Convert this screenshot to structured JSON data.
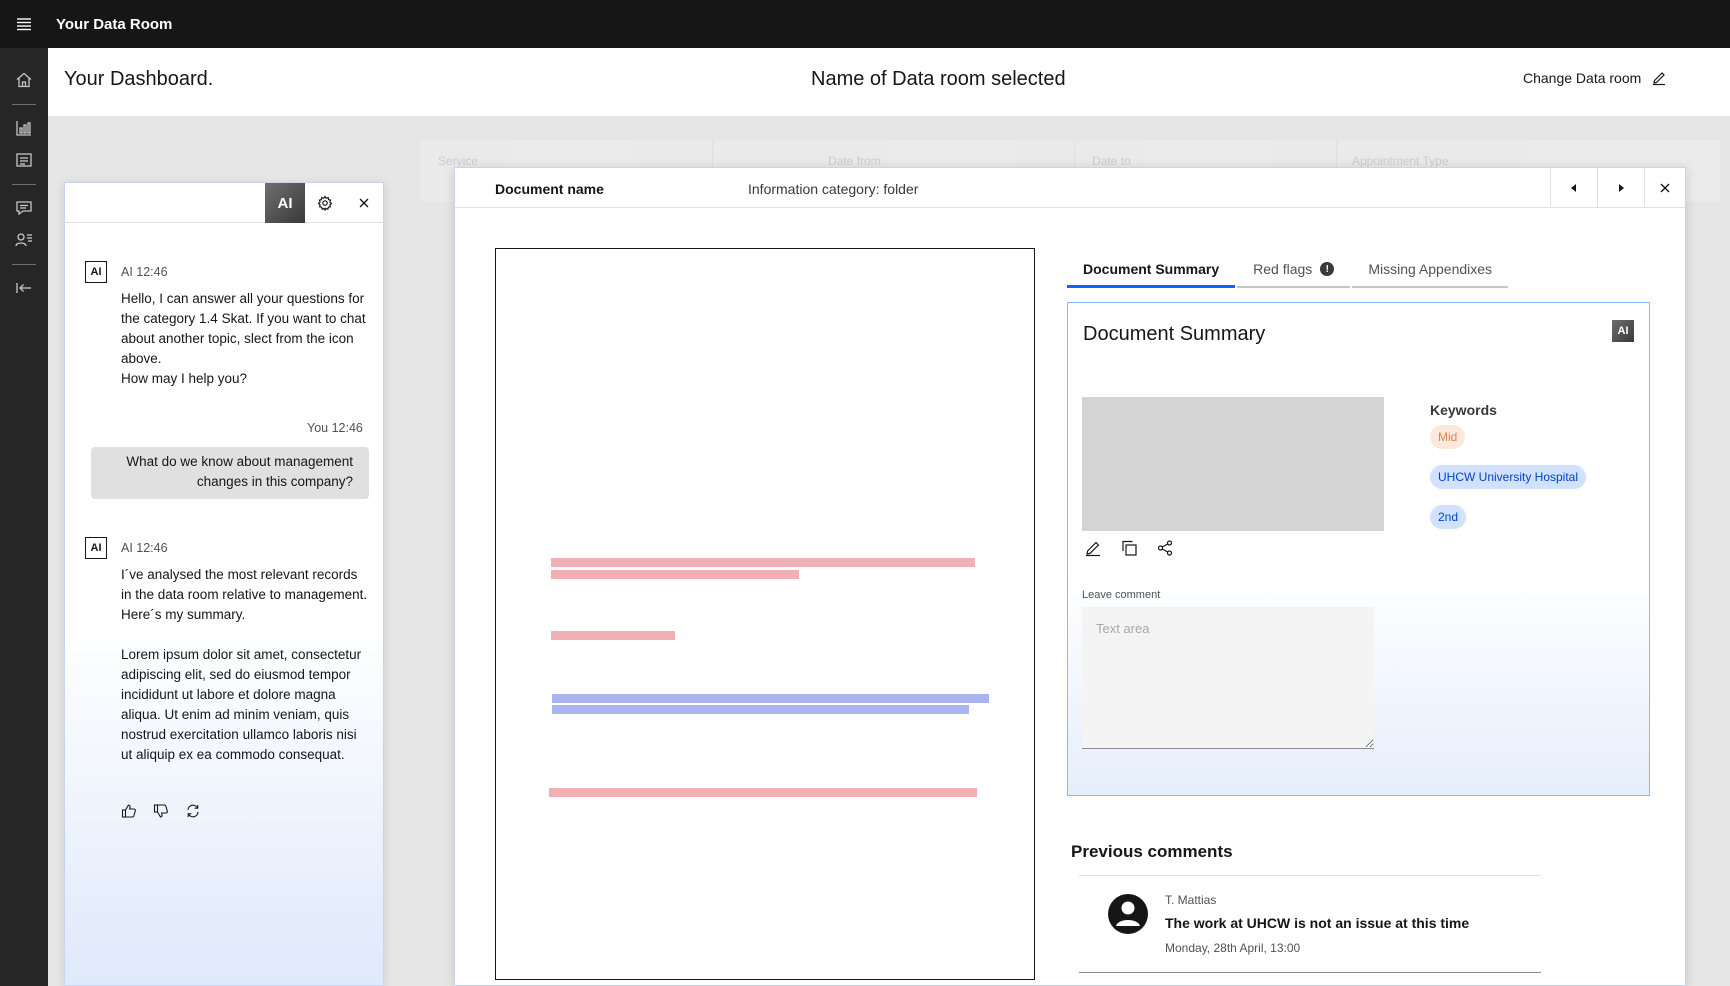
{
  "app": {
    "title": "Your Data Room"
  },
  "sidebar": {
    "items": [
      {
        "icon": "home-icon"
      },
      {
        "icon": "bar-chart-icon"
      },
      {
        "icon": "document-list-icon"
      },
      {
        "icon": "chat-icon"
      },
      {
        "icon": "user-list-icon"
      },
      {
        "icon": "logout-icon"
      }
    ]
  },
  "header": {
    "title": "Your Dashboard.",
    "dataroom_name": "Name of Data room selected",
    "change_label": "Change Data room"
  },
  "background_table": {
    "columns": [
      "Service",
      "Date from",
      "Date to",
      "Appointment Type"
    ]
  },
  "chat": {
    "ai_badge": "AI",
    "messages": [
      {
        "sender": "AI",
        "meta": "AI 12:46",
        "text": "Hello, I can answer all your questions for the category 1.4 Skat. If you want to chat about another topic, slect from the icon above.\nHow may I help you?"
      },
      {
        "sender": "You",
        "meta": "You 12:46",
        "text": "What do we know about management changes in this company?"
      },
      {
        "sender": "AI",
        "meta": "AI 12:46",
        "text": "I´ve analysed the most relevant records in the data room relative to management. Here´s my summary.\n\nLorem ipsum dolor sit amet, consectetur adipiscing elit, sed do eiusmod tempor incididunt ut labore et dolore magna aliqua. Ut enim ad minim veniam, quis nostrud exercitation ullamco laboris nisi ut aliquip ex ea commodo consequat."
      }
    ]
  },
  "document": {
    "name": "Document name",
    "category": "Information category: folder",
    "tabs": [
      {
        "label": "Document Summary",
        "active": true
      },
      {
        "label": "Red flags",
        "info": "!"
      },
      {
        "label": "Missing Appendixes"
      }
    ],
    "summary": {
      "title": "Document Summary",
      "ai_badge": "AI",
      "keywords_label": "Keywords",
      "keywords": [
        {
          "label": "Mid",
          "color": "#fde9dc"
        },
        {
          "label": "UHCW University Hospital",
          "color": "#d0e2ff"
        },
        {
          "label": "2nd",
          "color": "#d0e2ff"
        }
      ],
      "comment_label": "Leave comment",
      "comment_placeholder": "Text area",
      "comment_value": ""
    },
    "previous_comments": {
      "title": "Previous comments",
      "items": [
        {
          "author": "T. Mattias",
          "text": "The work at UHCW is not an issue at this time",
          "date": "Monday, 28th April, 13:00"
        }
      ]
    }
  },
  "colors": {
    "accent": "#0f62fe",
    "highlight_red": "#efb1b3",
    "highlight_blue": "#aab4ee"
  }
}
